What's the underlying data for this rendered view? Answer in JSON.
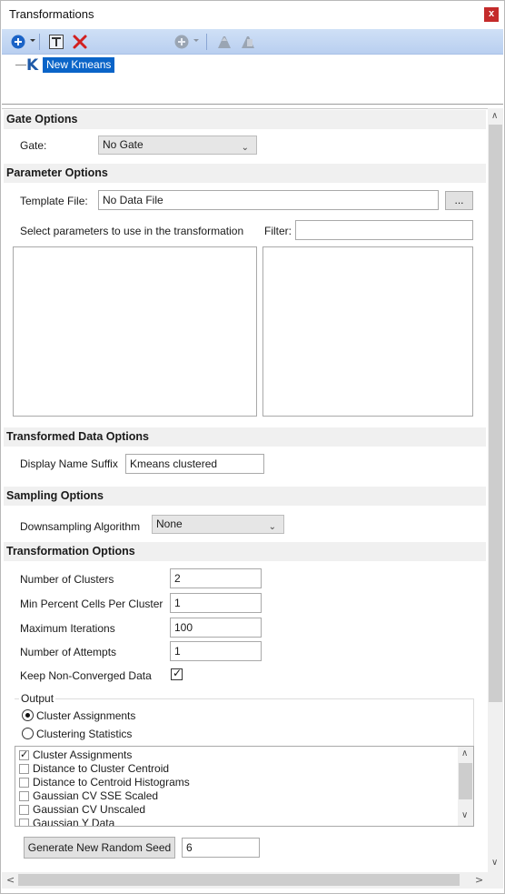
{
  "window": {
    "title": "Transformations",
    "close_label": "x"
  },
  "toolbar": {
    "icons": [
      "add-icon",
      "dropdown-caret-icon",
      "text-icon",
      "delete-icon",
      "add-disabled-icon",
      "move-up-disabled-icon",
      "move-down-disabled-icon"
    ]
  },
  "tree": {
    "items": [
      {
        "icon": "K",
        "label": "New Kmeans",
        "selected": true
      }
    ]
  },
  "gate_options": {
    "header": "Gate Options",
    "gate_label": "Gate:",
    "gate_value": "No Gate"
  },
  "parameter_options": {
    "header": "Parameter Options",
    "template_label": "Template File:",
    "template_value": "No Data File",
    "browse_label": "...",
    "select_label": "Select parameters to use in the transformation",
    "filter_label": "Filter:",
    "filter_value": ""
  },
  "transformed_data_options": {
    "header": "Transformed Data Options",
    "suffix_label": "Display Name Suffix",
    "suffix_value": "Kmeans clustered"
  },
  "sampling_options": {
    "header": "Sampling Options",
    "algorithm_label": "Downsampling Algorithm",
    "algorithm_value": "None"
  },
  "transformation_options": {
    "header": "Transformation Options",
    "clusters_label": "Number of Clusters",
    "clusters_value": "2",
    "min_percent_label": "Min Percent Cells Per Cluster",
    "min_percent_value": "1",
    "max_iter_label": "Maximum Iterations",
    "max_iter_value": "100",
    "attempts_label": "Number of Attempts",
    "attempts_value": "1",
    "keep_label": "Keep Non-Converged Data",
    "keep_checked": true,
    "output_group_label": "Output",
    "output_options": [
      {
        "label": "Cluster Assignments",
        "selected": true
      },
      {
        "label": "Clustering Statistics",
        "selected": false
      }
    ],
    "output_items": [
      {
        "label": "Cluster Assignments",
        "checked": true
      },
      {
        "label": "Distance to Cluster Centroid",
        "checked": false
      },
      {
        "label": "Distance to Centroid Histograms",
        "checked": false
      },
      {
        "label": "Gaussian CV SSE Scaled",
        "checked": false
      },
      {
        "label": "Gaussian CV Unscaled",
        "checked": false
      },
      {
        "label": "Gaussian Y Data",
        "checked": false
      }
    ],
    "seed_button_label": "Generate New Random Seed",
    "seed_value": "6"
  },
  "glyphs": {
    "chevron_down": "⌄",
    "check": "✓",
    "arrow_up": "∧",
    "arrow_down": "∨",
    "arrow_left": "<",
    "arrow_right": ">"
  }
}
